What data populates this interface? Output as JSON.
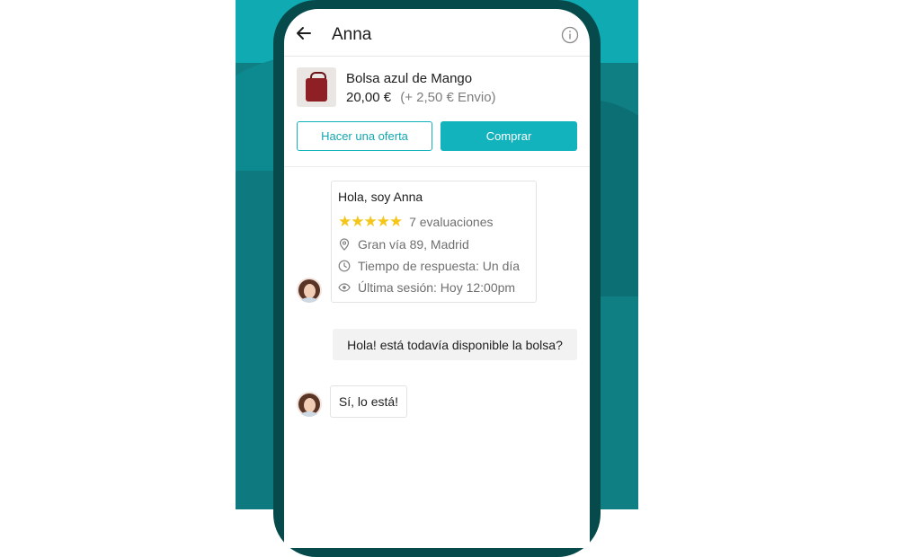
{
  "header": {
    "title": "Anna",
    "back_icon": "arrow-left-icon",
    "info_icon": "info-icon"
  },
  "product": {
    "name": "Bolsa azul de Mango",
    "price": "20,00 €",
    "shipping": "(+ 2,50 € Envio)",
    "offer_label": "Hacer una oferta",
    "buy_label": "Comprar"
  },
  "profile": {
    "greeting": "Hola, soy Anna",
    "stars": "★★★★★",
    "reviews": "7 evaluaciones",
    "location": "Gran vía 89, Madrid",
    "response_time": "Tiempo de respuesta: Un día",
    "last_seen": "Última sesión: Hoy 12:00pm"
  },
  "messages": [
    {
      "from": "me",
      "text": "Hola! está todavía disponible la bolsa?"
    },
    {
      "from": "seller",
      "text": "Sí, lo está!"
    }
  ],
  "colors": {
    "accent": "#13b3bd",
    "star": "#f5c518",
    "phone_frame": "#064a4c",
    "background": "#0f7f84"
  }
}
